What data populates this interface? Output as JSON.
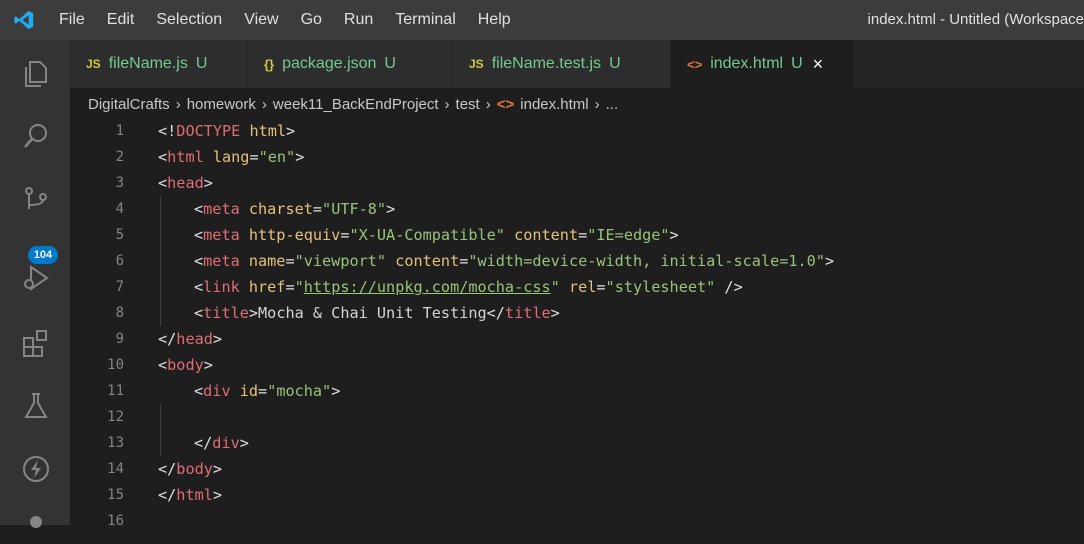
{
  "menu": [
    "File",
    "Edit",
    "Selection",
    "View",
    "Go",
    "Run",
    "Terminal",
    "Help"
  ],
  "window_title": "index.html - Untitled (Workspace",
  "activity": {
    "badge": "104"
  },
  "tabs": [
    {
      "icon": "JS",
      "name": "fileName.js",
      "status": "U"
    },
    {
      "icon": "{}",
      "name": "package.json",
      "status": "U"
    },
    {
      "icon": "JS",
      "name": "fileName.test.js",
      "status": "U"
    },
    {
      "icon": "<>",
      "name": "index.html",
      "status": "U",
      "close": "×"
    }
  ],
  "breadcrumb": {
    "items": [
      "DigitalCrafts",
      "homework",
      "week11_BackEndProject",
      "test"
    ],
    "file_icon": "<>",
    "file": "index.html",
    "trailing": "..."
  },
  "lines": [
    {
      "n": "1",
      "tokens": [
        "<!",
        "DOCTYPE",
        " html",
        ">"
      ]
    },
    {
      "n": "2",
      "tokens": [
        "<",
        "html",
        " lang",
        "=",
        "\"en\"",
        ">"
      ]
    },
    {
      "n": "3",
      "tokens": [
        "<",
        "head",
        ">"
      ]
    },
    {
      "n": "4",
      "tokens": [
        "<",
        "meta",
        " charset",
        "=",
        "\"UTF-8\"",
        ">"
      ]
    },
    {
      "n": "5",
      "tokens": [
        "<",
        "meta",
        " http-equiv",
        "=",
        "\"X-UA-Compatible\"",
        " content",
        "=",
        "\"IE=edge\"",
        ">"
      ]
    },
    {
      "n": "6",
      "tokens": [
        "<",
        "meta",
        " name",
        "=",
        "\"viewport\"",
        " content",
        "=",
        "\"width=device-width, initial-scale=1.0\"",
        ">"
      ]
    },
    {
      "n": "7",
      "tokens": [
        "<",
        "link",
        " href",
        "=",
        "\"",
        "https://unpkg.com/mocha-css",
        "\"",
        " rel",
        "=",
        "\"stylesheet\"",
        " />"
      ]
    },
    {
      "n": "8",
      "tokens": [
        "<",
        "title",
        ">",
        "Mocha & Chai Unit Testing",
        "</",
        "title",
        ">"
      ]
    },
    {
      "n": "9",
      "tokens": [
        "</",
        "head",
        ">"
      ]
    },
    {
      "n": "10",
      "tokens": [
        "<",
        "body",
        ">"
      ]
    },
    {
      "n": "11",
      "tokens": [
        "<",
        "div",
        " id",
        "=",
        "\"mocha\"",
        ">"
      ]
    },
    {
      "n": "12",
      "tokens": []
    },
    {
      "n": "13",
      "tokens": [
        "</",
        "div",
        ">"
      ]
    },
    {
      "n": "14",
      "tokens": [
        "</",
        "body",
        ">"
      ]
    },
    {
      "n": "15",
      "tokens": [
        "</",
        "html",
        ">"
      ]
    },
    {
      "n": "16",
      "tokens": []
    }
  ],
  "colors": {
    "tag": "#e06c75",
    "attr": "#e5c07b",
    "string": "#98c379",
    "accent": "#007acc"
  }
}
